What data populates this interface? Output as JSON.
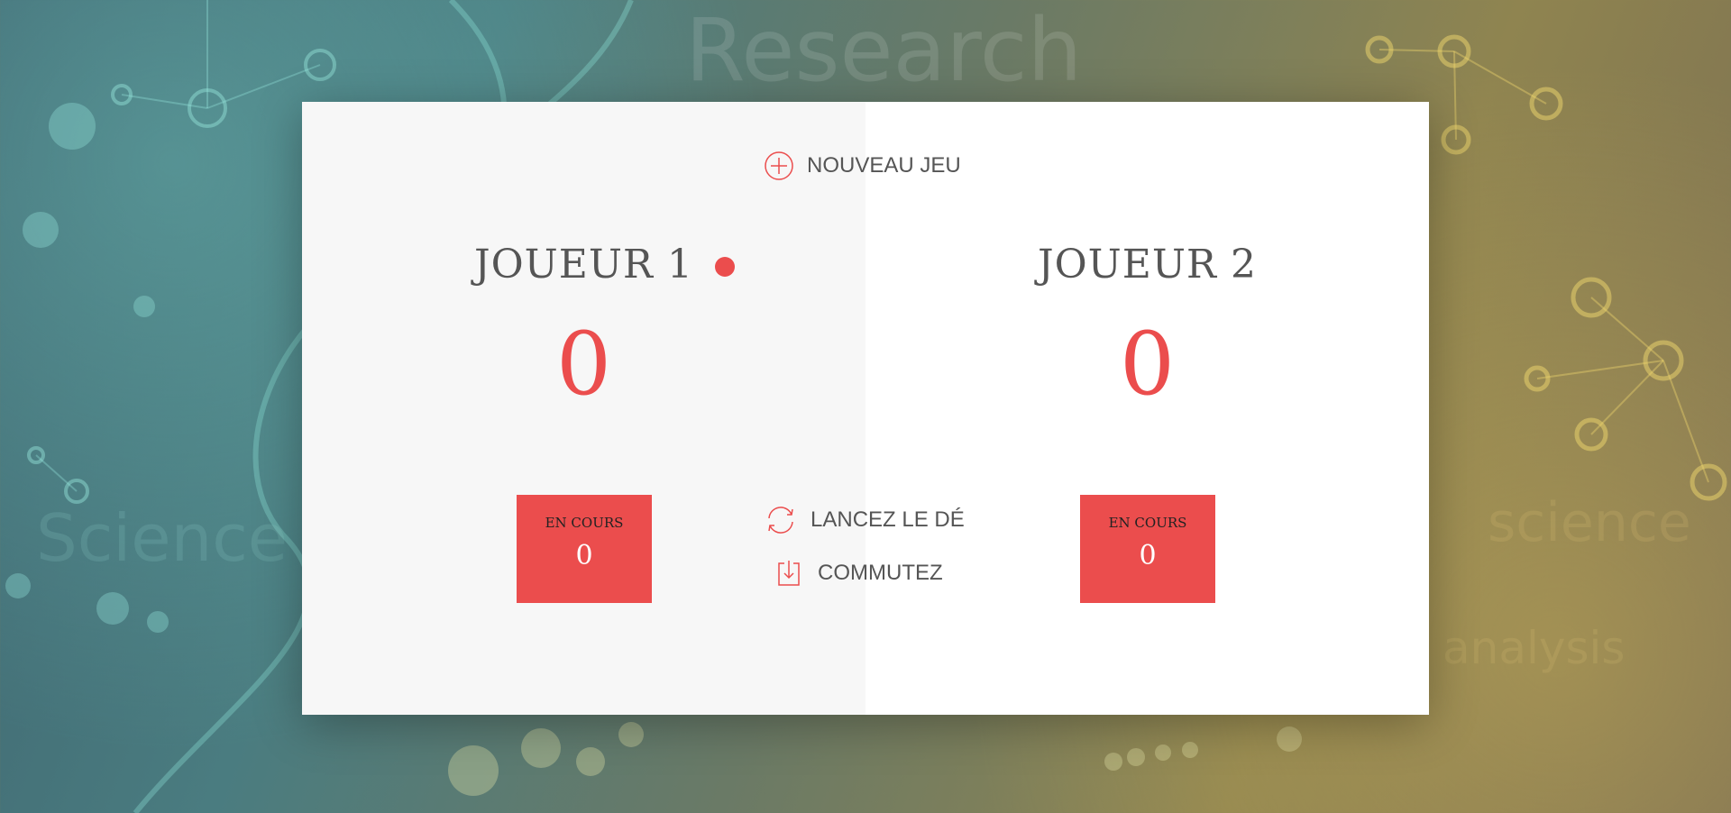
{
  "background": {
    "words": [
      "Research",
      "Science",
      "science",
      "analysis"
    ]
  },
  "game": {
    "new_game_label": "NOUVEAU JEU",
    "roll_dice_label": "LANCEZ LE DÉ",
    "hold_label": "COMMUTEZ",
    "accent_color": "#EB4D4D",
    "active_player": 1,
    "players": [
      {
        "name": "JOUEUR 1",
        "score": "0",
        "current_label": "EN COURS",
        "current_score": "0"
      },
      {
        "name": "JOUEUR 2",
        "score": "0",
        "current_label": "EN COURS",
        "current_score": "0"
      }
    ]
  },
  "icons": {
    "new_game": "plus-circle-icon",
    "roll_dice": "refresh-icon",
    "hold": "download-icon",
    "active_indicator": "active-player-dot"
  }
}
